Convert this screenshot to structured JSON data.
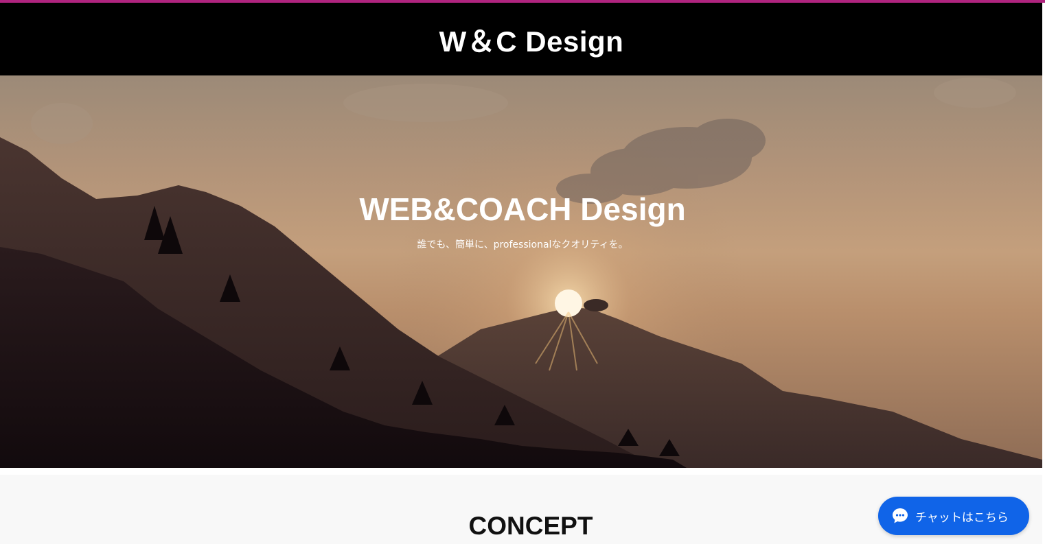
{
  "header": {
    "site_title": "W＆C Design"
  },
  "hero": {
    "title": "WEB&COACH Design",
    "subtitle": "誰でも、簡単に、professionalなクオリティを。"
  },
  "concept": {
    "heading": "CONCEPT"
  },
  "chat": {
    "label": "チャットはこちら",
    "icon": "chat-bubble-icon"
  },
  "colors": {
    "accent_bar": "#b0247f",
    "header_bg": "#000000",
    "chat_button": "#1064e8",
    "section_bg": "#f8f8f8"
  }
}
